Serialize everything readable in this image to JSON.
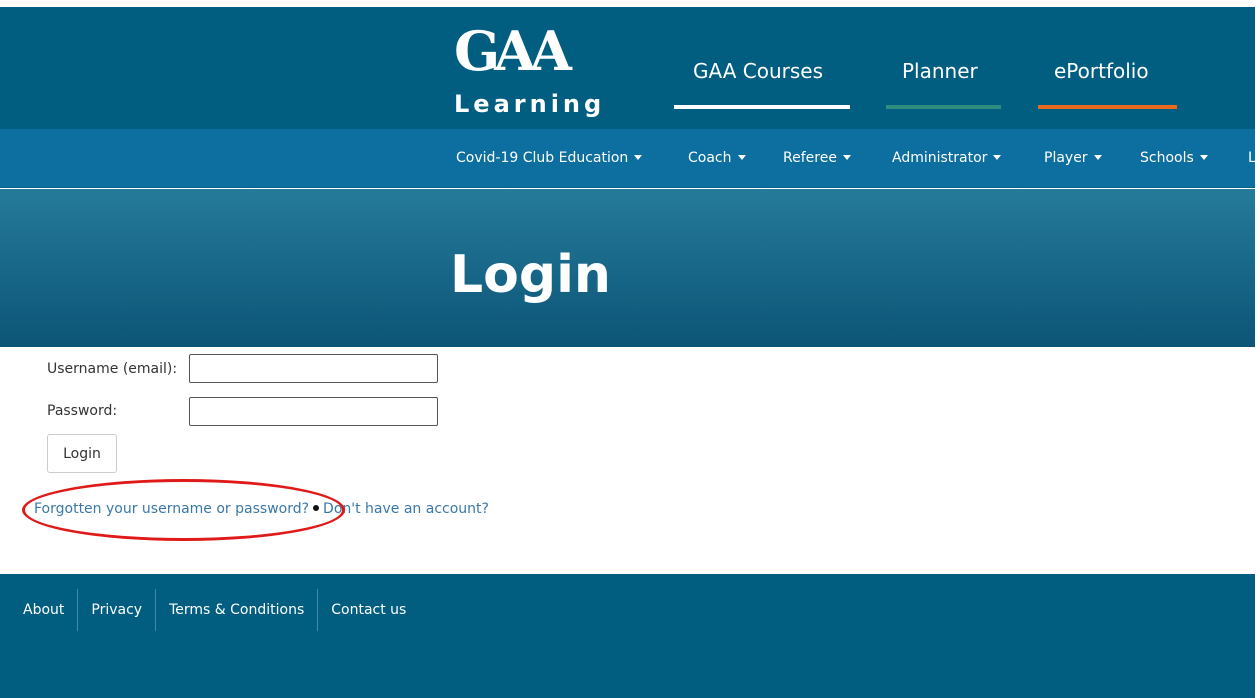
{
  "header": {
    "logo": {
      "mark": "GAA",
      "sub": "Learning"
    },
    "top_nav": [
      {
        "label": "GAA Courses",
        "underline_color": "#ffffff"
      },
      {
        "label": "Planner",
        "underline_color": "#2e8d7f"
      },
      {
        "label": "ePortfolio",
        "underline_color": "#e8691f"
      }
    ],
    "sub_nav": [
      {
        "label": "Covid-19 Club Education"
      },
      {
        "label": "Coach"
      },
      {
        "label": "Referee"
      },
      {
        "label": "Administrator"
      },
      {
        "label": "Player"
      },
      {
        "label": "Schools"
      },
      {
        "label": "L"
      }
    ]
  },
  "hero": {
    "title": "Login"
  },
  "form": {
    "username_label": "Username (email):",
    "username_value": "",
    "password_label": "Password:",
    "password_value": "",
    "login_button": "Login"
  },
  "links": {
    "forgot": "Forgotten your username or password?",
    "no_account": "Don't have an account?"
  },
  "footer": {
    "links": [
      "About",
      "Privacy",
      "Terms & Conditions",
      "Contact us"
    ]
  },
  "colors": {
    "header_bg": "#015e80",
    "subnav_bg": "#0d6fa0",
    "link": "#3a78a8",
    "annotation": "#e01919"
  }
}
